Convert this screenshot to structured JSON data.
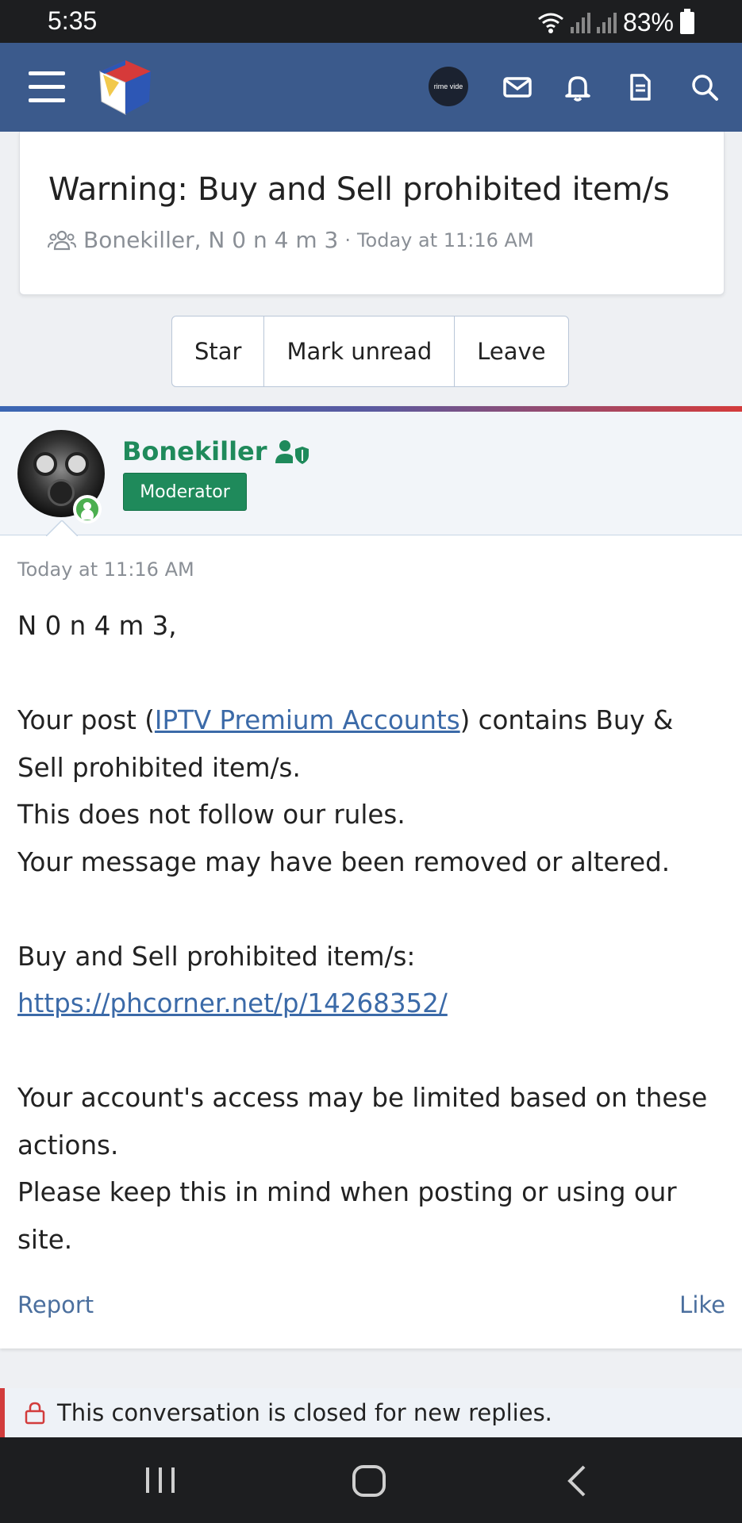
{
  "status_bar": {
    "time": "5:35",
    "battery": "83%"
  },
  "app_bar": {
    "prime_label": "rime vide"
  },
  "thread": {
    "title": "Warning: Buy and Sell prohibited item/s",
    "participants": "Bonekiller, N 0 n 4 m 3",
    "separator": "·",
    "time": "Today at 11:16 AM"
  },
  "buttons": {
    "star": "Star",
    "mark_unread": "Mark unread",
    "leave": "Leave"
  },
  "message": {
    "author": "Bonekiller",
    "role": "Moderator",
    "time": "Today at 11:16 AM",
    "greeting": "N 0 n 4 m 3,",
    "line1_pre": "Your post (",
    "line1_link": "IPTV Premium Accounts",
    "line1_post": ") contains Buy & Sell prohibited item/s.",
    "line2": "This does not follow our rules.",
    "line3": "Your message may have been removed or altered.",
    "line4": "Buy and Sell prohibited item/s:",
    "line4_link": "https://phcorner.net/p/14268352/",
    "line5": "Your account's access may be limited based on these actions.",
    "line6": "Please keep this in mind when posting or using our site.",
    "report": "Report",
    "like": "Like"
  },
  "closed_notice": "This conversation is closed for new replies.",
  "colors": {
    "header": "#3b5a8c",
    "moderator": "#1f8a5b",
    "link": "#3b6aa8"
  }
}
